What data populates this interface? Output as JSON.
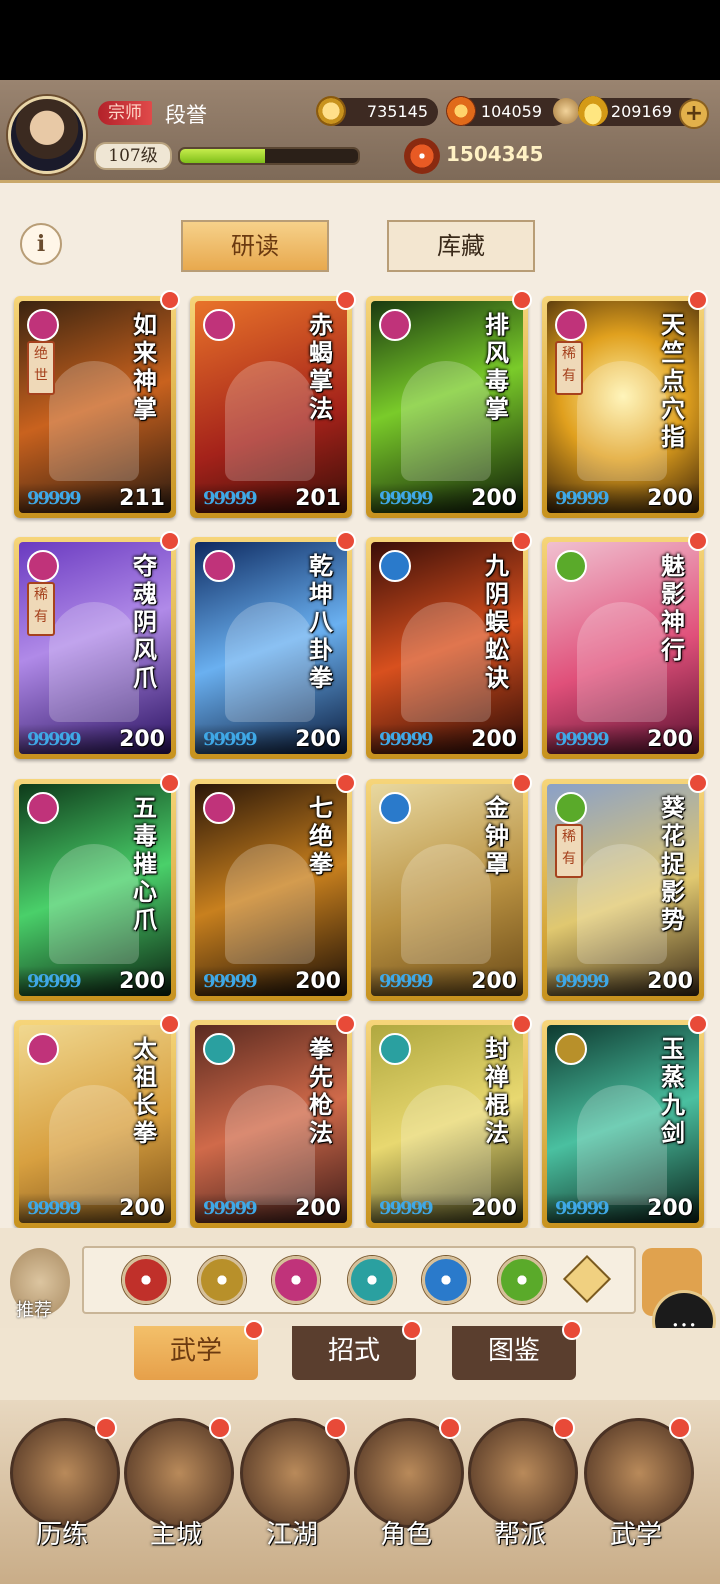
{
  "player": {
    "title_badge": "宗师",
    "name": "段誉",
    "level": "107级",
    "exp_progress": 0.48,
    "power": "1504345"
  },
  "resources": {
    "copper": "735145",
    "gems": "104059",
    "gold": "209169"
  },
  "top_tabs": {
    "study": "研读",
    "collection": "库藏"
  },
  "cards": [
    {
      "name": "如来神掌",
      "tag": "绝世",
      "level": "211",
      "drops": "99999",
      "bg": "linear-gradient(160deg,#3b2410,#c9621e 50%,#2a1a10)",
      "type_color": "#c0337a"
    },
    {
      "name": "赤蝎掌法",
      "tag": "",
      "level": "201",
      "drops": "99999",
      "bg": "linear-gradient(160deg,#e8732a,#a4221a 60%,#3a0e08)",
      "type_color": "#c0337a"
    },
    {
      "name": "排风毒掌",
      "tag": "",
      "level": "200",
      "drops": "99999",
      "bg": "linear-gradient(160deg,#1a3a10,#7acb2a 45%,#0e1a08)",
      "type_color": "#c0337a"
    },
    {
      "name": "天竺点穴指",
      "tag": "稀有",
      "level": "200",
      "drops": "99999",
      "bg": "radial-gradient(circle at 50% 45%,#fff2a8,#e0a01e 45%,#3a2208)",
      "type_color": "#c0337a"
    },
    {
      "name": "夺魂阴风爪",
      "tag": "稀有",
      "level": "200",
      "drops": "99999",
      "bg": "linear-gradient(160deg,#6a3ac0,#b08ae8 45%,#2a1260)",
      "type_color": "#c0337a"
    },
    {
      "name": "乾坤八卦拳",
      "tag": "",
      "level": "200",
      "drops": "99999",
      "bg": "linear-gradient(160deg,#0e2a60,#6ab0f0 50%,#0a1a3a)",
      "type_color": "#c0337a"
    },
    {
      "name": "九阴蜈蚣诀",
      "tag": "",
      "level": "200",
      "drops": "99999",
      "bg": "linear-gradient(160deg,#3a0e08,#d8501e 50%,#2a0a06)",
      "type_color": "#2a7acb"
    },
    {
      "name": "魅影神行",
      "tag": "",
      "level": "200",
      "drops": "99999",
      "bg": "linear-gradient(160deg,#f0c0d0,#e0507a 55%,#5a1030)",
      "type_color": "#5aaa2a"
    },
    {
      "name": "五毒摧心爪",
      "tag": "",
      "level": "200",
      "drops": "99999",
      "bg": "linear-gradient(160deg,#0e3a1a,#4ad06a 50%,#0a2010)",
      "type_color": "#c0337a"
    },
    {
      "name": "七绝拳",
      "tag": "",
      "level": "200",
      "drops": "99999",
      "bg": "linear-gradient(160deg,#2a1608,#c8801e 50%,#1a0e06)",
      "type_color": "#c0337a"
    },
    {
      "name": "金钟罩",
      "tag": "",
      "level": "200",
      "drops": "99999",
      "bg": "linear-gradient(160deg,#e8d8a0,#b89040 55%,#6a4a18)",
      "type_color": "#2a7acb"
    },
    {
      "name": "葵花捉影势",
      "tag": "稀有",
      "level": "200",
      "drops": "99999",
      "bg": "linear-gradient(160deg,#8aa0c8,#e0c870 55%,#3a2a18)",
      "type_color": "#5aaa2a"
    },
    {
      "name": "太祖长拳",
      "tag": "",
      "level": "200",
      "drops": "99999",
      "bg": "linear-gradient(160deg,#f0d890,#d8a040 55%,#7a5018)",
      "type_color": "#c0337a"
    },
    {
      "name": "拳先枪法",
      "tag": "",
      "level": "200",
      "drops": "99999",
      "bg": "linear-gradient(160deg,#5a2a20,#d06a4a 50%,#3a1a18)",
      "type_color": "#2aa0a0"
    },
    {
      "name": "封禅棍法",
      "tag": "",
      "level": "200",
      "drops": "99999",
      "bg": "linear-gradient(160deg,#b0a840,#e8d870 50%,#3a3a18)",
      "type_color": "#2aa0a0"
    },
    {
      "name": "玉蒸九剑",
      "tag": "",
      "level": "200",
      "drops": "99999",
      "bg": "linear-gradient(160deg,#0e3a30,#4ac0a0 50%,#0a2018)",
      "type_color": "#b8902a"
    }
  ],
  "filters": {
    "recommend": "推荐",
    "icons": [
      {
        "name": "sword-filter-icon",
        "color": "#c0302a"
      },
      {
        "name": "spear-filter-icon",
        "color": "#b8902a"
      },
      {
        "name": "palm-filter-icon",
        "color": "#c0337a"
      },
      {
        "name": "fan-filter-icon",
        "color": "#2aa0a0"
      },
      {
        "name": "taiji-filter-icon",
        "color": "#2a7acb"
      },
      {
        "name": "teapot-filter-icon",
        "color": "#5aaa2a"
      }
    ]
  },
  "sub_tabs": {
    "martial": "武学",
    "moves": "招式",
    "atlas": "图鉴"
  },
  "nav": [
    {
      "label": "历练",
      "dot": true
    },
    {
      "label": "主城",
      "dot": true
    },
    {
      "label": "江湖",
      "dot": true
    },
    {
      "label": "角色",
      "dot": true
    },
    {
      "label": "帮派",
      "dot": true
    },
    {
      "label": "武学",
      "dot": true
    }
  ]
}
